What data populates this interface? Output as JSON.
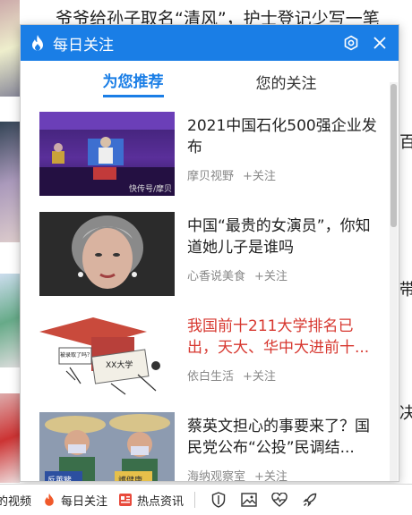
{
  "background": {
    "headline": "爷爷给孙子取名“清风”，护士登记少写一笔",
    "right_fragments": [
      "百",
      "带",
      "决"
    ]
  },
  "popup": {
    "title": "每日关注",
    "tabs": [
      {
        "label": "为您推荐",
        "active": true
      },
      {
        "label": "您的关注",
        "active": false
      }
    ],
    "items": [
      {
        "title": "2021中国石化500强企业发布",
        "source": "摩贝视野",
        "follow": "+关注",
        "title_color": "normal"
      },
      {
        "title": "中国“最贵的女演员”，你知道她儿子是谁吗",
        "source": "心香说美食",
        "follow": "+关注",
        "title_color": "normal"
      },
      {
        "title": "我国前十211大学排名已出，天大、华中大进前十...",
        "source": "依白生活",
        "follow": "+关注",
        "title_color": "red"
      },
      {
        "title": "蔡英文担心的事要来了？国民党公布“公投”民调结...",
        "source": "海纳观察室",
        "follow": "+关注",
        "title_color": "normal"
      }
    ],
    "thumb_texts": {
      "item1_watermark": "快传号/摩贝",
      "item3_cap_label": "XX大学",
      "item3_note": "被录取了吗？",
      "item4_sign_a": "反萊豬",
      "item4_sign_b": "護健康"
    }
  },
  "taskbar": {
    "video_label": "的视频",
    "follow_label": "每日关注",
    "news_label": "热点资讯",
    "icons": [
      "shield-icon",
      "image-icon",
      "heart-pulse-icon",
      "rocket-icon"
    ]
  },
  "colors": {
    "accent": "#1a7ee6",
    "highlight_title": "#d7372f",
    "flame": "#f0592a"
  }
}
